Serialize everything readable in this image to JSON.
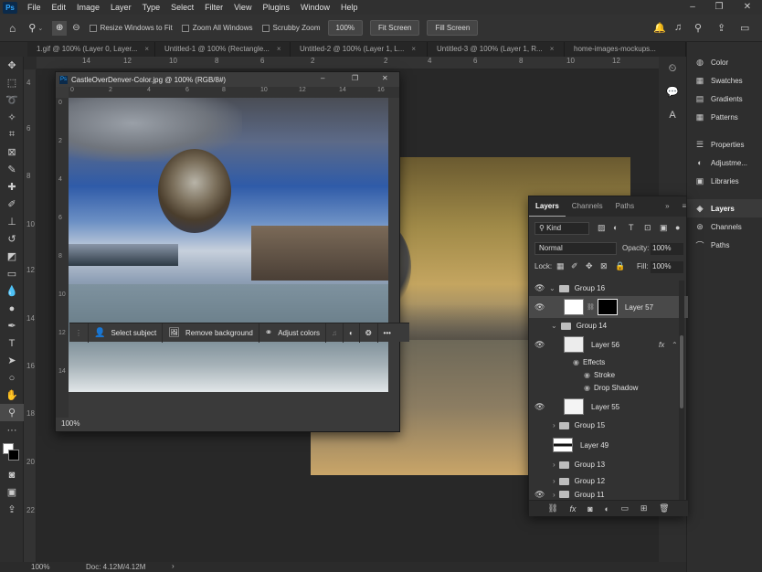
{
  "menu": {
    "app_icon": "Ps",
    "items": [
      "File",
      "Edit",
      "Image",
      "Layer",
      "Type",
      "Select",
      "Filter",
      "View",
      "Plugins",
      "Window",
      "Help"
    ],
    "window_controls": [
      "–",
      "❐",
      "✕"
    ]
  },
  "options_bar": {
    "resize_windows": "Resize Windows to Fit",
    "zoom_all": "Zoom All Windows",
    "scrubby_zoom": "Scrubby Zoom",
    "zoom_value": "100%",
    "fit_screen": "Fit Screen",
    "fill_screen": "Fill Screen"
  },
  "doc_tabs": [
    "1.gif @ 100% (Layer 0, Layer...",
    "Untitled-1 @ 100% (Rectangle...",
    "Untitled-2 @ 100% (Layer 1, L...",
    "Untitled-3 @ 100% (Layer 1, R...",
    "home-images-mockups..."
  ],
  "ruler_top": [
    "14",
    "12",
    "10",
    "8",
    "6",
    "4",
    "2",
    "0",
    "2",
    "4",
    "6",
    "8",
    "10",
    "12"
  ],
  "ruler_left": [
    "4",
    "6",
    "8",
    "10",
    "12",
    "14",
    "16",
    "18",
    "20",
    "22"
  ],
  "floating_window": {
    "title": "CastleOverDenver-Color.jpg @ 100% (RGB/8#)",
    "ruler_top": [
      "0",
      "2",
      "4",
      "6",
      "8",
      "10",
      "12",
      "14",
      "16"
    ],
    "ruler_left": [
      "0",
      "2",
      "4",
      "6",
      "8",
      "10",
      "12",
      "14"
    ],
    "zoom": "100%"
  },
  "contextual_taskbar": {
    "select_subject": "Select subject",
    "remove_background": "Remove background",
    "adjust_colors": "Adjust colors"
  },
  "status": {
    "zoom": "100%",
    "doc": "Doc: 4.12M/4.12M"
  },
  "right_panels": [
    "Color",
    "Swatches",
    "Gradients",
    "Patterns",
    "Properties",
    "Adjustme...",
    "Libraries",
    "Layers",
    "Channels",
    "Paths"
  ],
  "layers_panel": {
    "tabs": [
      "Layers",
      "Channels",
      "Paths"
    ],
    "filter_kind": "Kind",
    "blend_mode": "Normal",
    "opacity_label": "Opacity:",
    "opacity_value": "100%",
    "lock_label": "Lock:",
    "fill_label": "Fill:",
    "fill_value": "100%",
    "layers": [
      {
        "name": "Group 16"
      },
      {
        "name": "Layer 57"
      },
      {
        "name": "Group 14"
      },
      {
        "name": "Layer 56",
        "fx": "fx"
      },
      {
        "name": "Effects"
      },
      {
        "name": "Stroke"
      },
      {
        "name": "Drop Shadow"
      },
      {
        "name": "Layer 55"
      },
      {
        "name": "Group 15"
      },
      {
        "name": "Layer 49"
      },
      {
        "name": "Group 13"
      },
      {
        "name": "Group 12"
      },
      {
        "name": "Group 11"
      }
    ]
  },
  "colors": {
    "accent": "#31a8ff",
    "panel": "#323232",
    "selected_row": "#494949"
  }
}
